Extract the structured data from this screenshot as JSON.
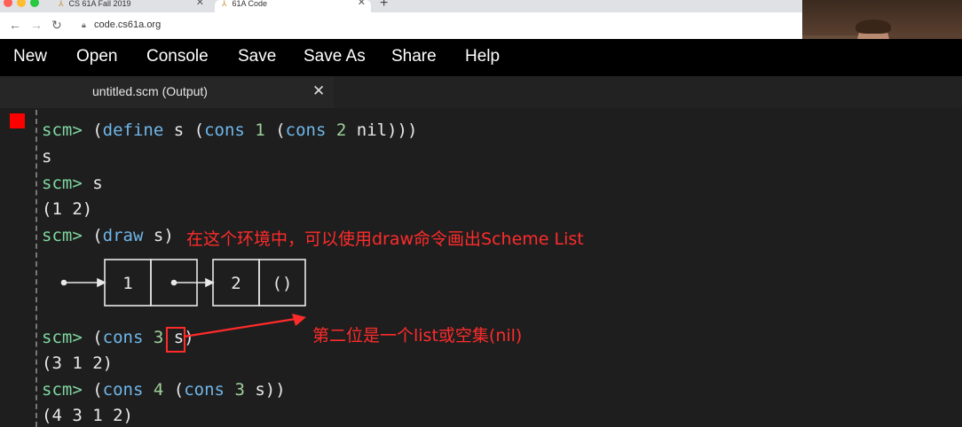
{
  "browser": {
    "tabs": [
      {
        "label": "CS 61A Fall 2019"
      },
      {
        "label": "61A Code"
      }
    ],
    "url": "code.cs61a.org"
  },
  "menu": {
    "new": "New",
    "open": "Open",
    "console": "Console",
    "save": "Save",
    "save_as": "Save As",
    "share": "Share",
    "help": "Help"
  },
  "file_tab": {
    "name": "untitled.scm (Output)",
    "close": "✕"
  },
  "console": {
    "prompt": "scm>",
    "l1": {
      "open": "(",
      "kw": "define",
      "a": " s (",
      "kw2": "cons",
      "sp": " ",
      "n1": "1",
      "b": " (",
      "kw3": "cons",
      "sp2": " ",
      "n2": "2",
      "c": " nil)))"
    },
    "o1": "s",
    "l2": " s",
    "o2": "(1 2)",
    "l3": {
      "open": "(",
      "kw": "draw",
      "rest": " s)"
    },
    "box_values": [
      "1",
      "2",
      "()"
    ],
    "l4": {
      "open": "(",
      "kw": "cons",
      "sp": " ",
      "n": "3",
      "sp2": " ",
      "s": "s",
      "close": ")"
    },
    "o4": "(3 1 2)",
    "l5": {
      "open": "(",
      "kw": "cons",
      "sp": " ",
      "n": "4",
      "b": " (",
      "kw2": "cons",
      "sp2": " ",
      "n2": "3",
      "c": " s))"
    },
    "o5": "(4 3 1 2)"
  },
  "annotations": {
    "draw_note": "在这个环境中，可以使用draw命令画出Scheme List",
    "second_note": "第二位是一个list或空集(nil)"
  },
  "colors": {
    "prompt": "#7fd7a0",
    "keyword": "#6fb6e8",
    "number": "#9ed29a",
    "annotation": "#ff2b2b"
  }
}
